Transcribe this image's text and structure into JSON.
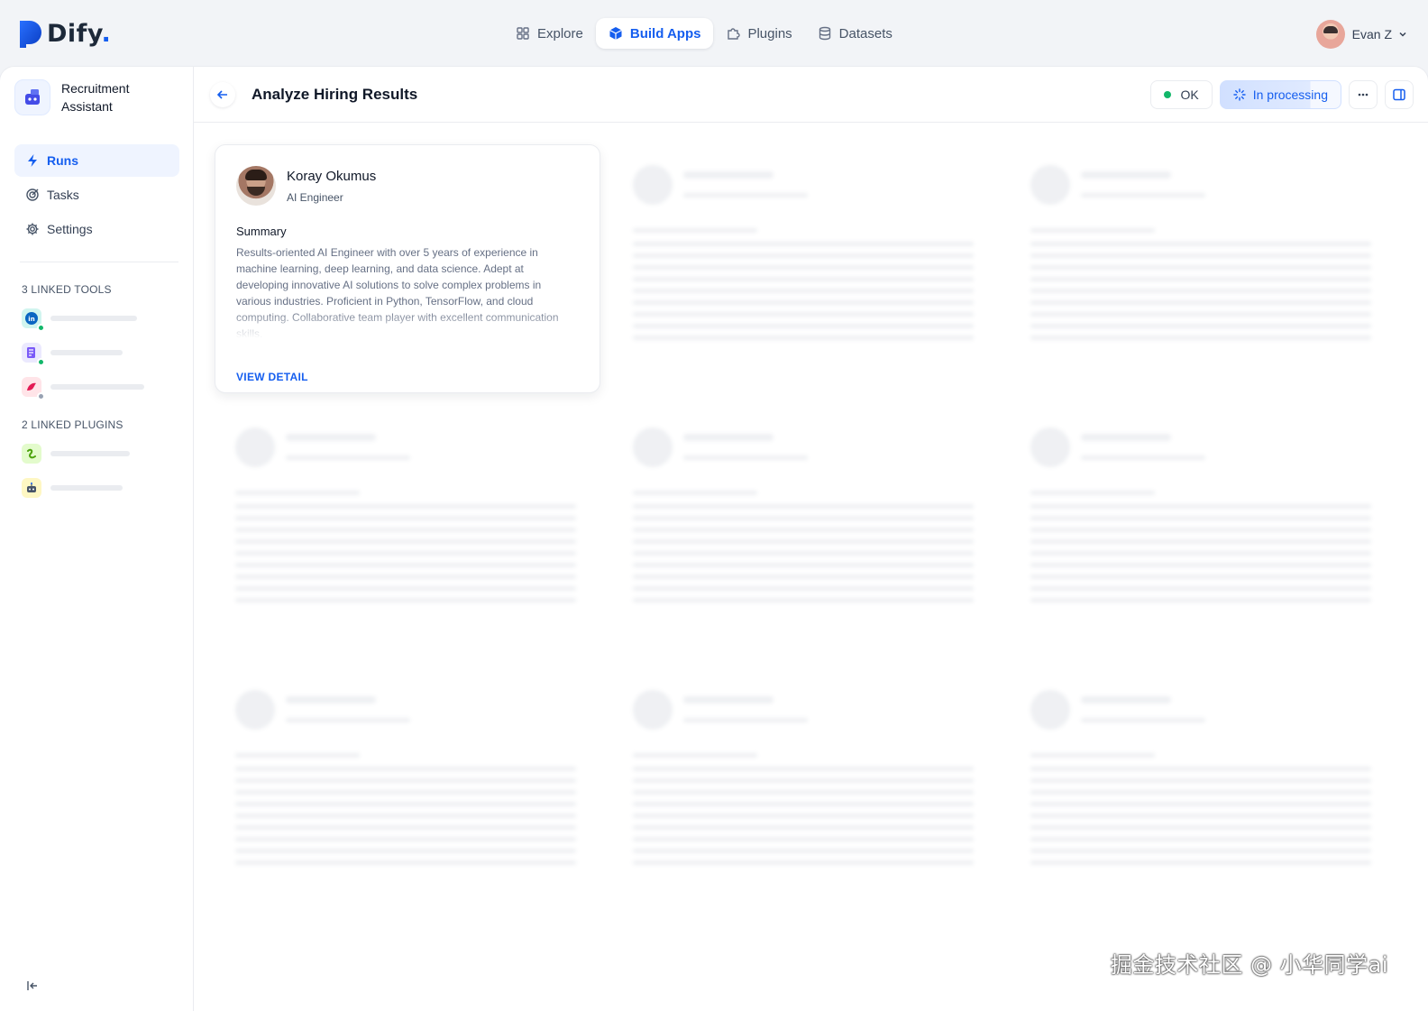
{
  "app": {
    "brand": "Dify",
    "brand_dot": "."
  },
  "nav": {
    "items": [
      {
        "label": "Explore",
        "icon": "grid-icon"
      },
      {
        "label": "Build Apps",
        "icon": "cube-icon",
        "active": true
      },
      {
        "label": "Plugins",
        "icon": "puzzle-icon"
      },
      {
        "label": "Datasets",
        "icon": "database-icon"
      }
    ]
  },
  "user": {
    "name": "Evan Z"
  },
  "sidebar": {
    "app_name": "Recruitment Assistant",
    "menu": [
      {
        "label": "Runs",
        "icon": "lightning-icon",
        "active": true
      },
      {
        "label": "Tasks",
        "icon": "target-icon"
      },
      {
        "label": "Settings",
        "icon": "gear-icon"
      }
    ],
    "tools_title": "3 LINKED TOOLS",
    "tools": [
      {
        "icon": "linkedin-icon",
        "status": "online"
      },
      {
        "icon": "form-icon",
        "status": "online"
      },
      {
        "icon": "bird-icon",
        "status": "offline"
      }
    ],
    "plugins_title": "2 LINKED PLUGINS",
    "plugins": [
      {
        "icon": "snake-icon"
      },
      {
        "icon": "robot-icon"
      }
    ]
  },
  "header": {
    "title": "Analyze Hiring Results",
    "status_ok": "OK",
    "status_processing": "In processing",
    "processing_progress": 0.75
  },
  "candidate": {
    "name": "Koray Okumus",
    "role": "AI Engineer",
    "summary_title": "Summary",
    "summary": "Results-oriented AI Engineer with over 5 years of experience in machine learning, deep learning, and data science. Adept at developing innovative AI solutions to solve complex problems in various industries. Proficient in Python, TensorFlow, and cloud computing. Collaborative team player with excellent communication skills.",
    "view_detail": "VIEW DETAIL"
  },
  "watermark": "掘金技术社区 @ 小华同学ai",
  "colors": {
    "accent": "#155eef",
    "ok_green": "#12b76a",
    "offline_gray": "#98a2b3"
  }
}
